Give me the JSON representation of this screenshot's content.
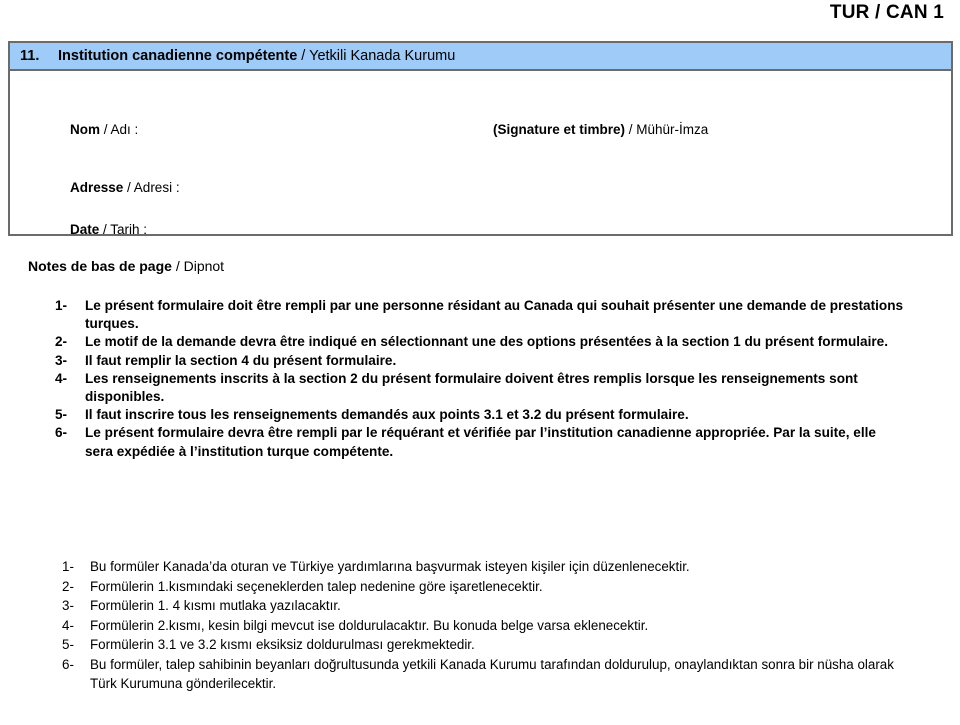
{
  "page": {
    "header_code": "TUR / CAN 1"
  },
  "section": {
    "number": "11.",
    "title_fr": "Institution canadienne compétente",
    "title_sep": " / ",
    "title_tr": "Yetkili Kanada Kurumu",
    "fields": [
      {
        "left_fr": "Nom",
        "left_tr": " / Adı :",
        "right_fr": "(Signature et timbre)",
        "right_tr": " / Mühür-İmza"
      },
      {
        "left_fr": "Adresse",
        "left_tr": " / Adresi :",
        "right_fr": "",
        "right_tr": ""
      },
      {
        "left_fr": "Date",
        "left_tr": " / Tarih :",
        "right_fr": "",
        "right_tr": ""
      }
    ]
  },
  "notes": {
    "heading_fr": "Notes de bas de page",
    "heading_tr": "  / Dipnot",
    "french_items": [
      {
        "num": "1-",
        "text": "Le présent formulaire doit être rempli par une personne résidant au Canada qui souhait présenter une demande de prestations turques."
      },
      {
        "num": "2-",
        "text": "Le motif de la demande devra être indiqué en sélectionnant une des options présentées à la section 1 du présent formulaire."
      },
      {
        "num": "3-",
        "text": "Il faut remplir la section 4 du présent formulaire."
      },
      {
        "num": "4-",
        "text": "Les renseignements inscrits à la section 2 du présent formulaire doivent êtres remplis lorsque les renseignements sont disponibles."
      },
      {
        "num": "5-",
        "text": "Il faut inscrire tous les renseignements demandés aux points 3.1 et 3.2  du présent formulaire."
      },
      {
        "num": "6-",
        "text": "Le présent formulaire devra être rempli par le réquérant et vérifiée par l’institution canadienne appropriée.  Par la suite, elle sera expédiée à l’institution turque compétente."
      }
    ],
    "turkish_items": [
      {
        "num": "1-",
        "text": "Bu formüler Kanada’da oturan ve Türkiye yardımlarına başvurmak isteyen kişiler için düzenlenecektir."
      },
      {
        "num": "2-",
        "text": "Formülerin 1.kısmındaki seçeneklerden talep nedenine göre işaretlenecektir."
      },
      {
        "num": "3-",
        "text": "Formülerin 1. 4 kısmı mutlaka yazılacaktır."
      },
      {
        "num": "4-",
        "text": "Formülerin 2.kısmı, kesin bilgi mevcut ise doldurulacaktır. Bu konuda belge varsa eklenecektir."
      },
      {
        "num": "5-",
        "text": "Formülerin 3.1 ve 3.2 kısmı eksiksiz doldurulması gerekmektedir."
      },
      {
        "num": "6-",
        "text": "Bu formüler, talep sahibinin beyanları doğrultusunda yetkili Kanada Kurumu tarafından doldurulup, onaylandıktan sonra bir nüsha olarak  Türk Kurumuna gönderilecektir."
      }
    ]
  },
  "colors": {
    "section_bar": "#9ecbf7",
    "border": "#6b6b6b",
    "text": "#000000"
  }
}
